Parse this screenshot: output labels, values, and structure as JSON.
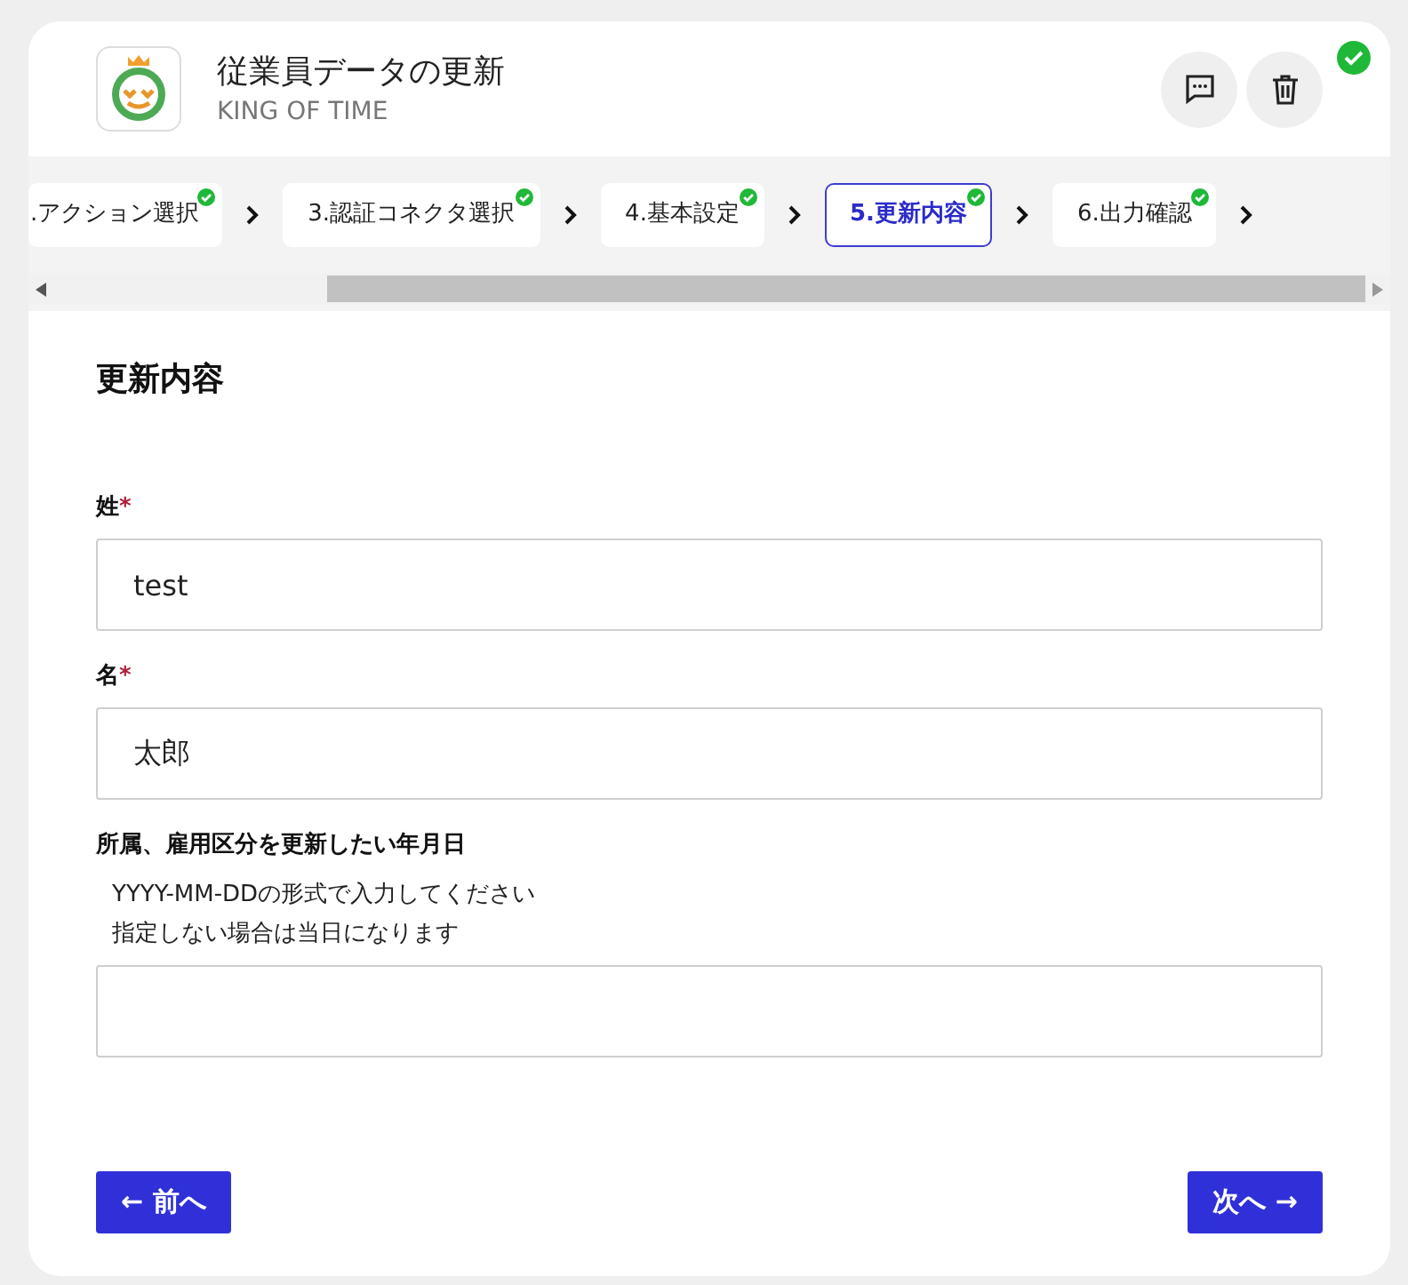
{
  "header": {
    "title": "従業員データの更新",
    "subtitle": "KING OF TIME",
    "verified": true
  },
  "steps": [
    {
      "label": ".アクション選択",
      "done": true,
      "selected": false
    },
    {
      "label": "3.認証コネクタ選択",
      "done": true,
      "selected": false
    },
    {
      "label": "4.基本設定",
      "done": true,
      "selected": false
    },
    {
      "label": "5.更新内容",
      "done": true,
      "selected": true
    },
    {
      "label": "6.出力確認",
      "done": true,
      "selected": false
    }
  ],
  "form": {
    "heading": "更新内容",
    "fields": [
      {
        "label": "姓",
        "required_mark": "*",
        "value": "test"
      },
      {
        "label": "名",
        "required_mark": "*",
        "value": "太郎"
      },
      {
        "label": "所属、雇用区分を更新したい年月日",
        "help": [
          "YYYY-MM-DDの形式で入力してください",
          "指定しない場合は当日になります"
        ]
      }
    ]
  },
  "buttons": [
    {
      "label": "← 前へ",
      "kind": "back"
    },
    {
      "label": "次へ →",
      "kind": "next"
    }
  ]
}
